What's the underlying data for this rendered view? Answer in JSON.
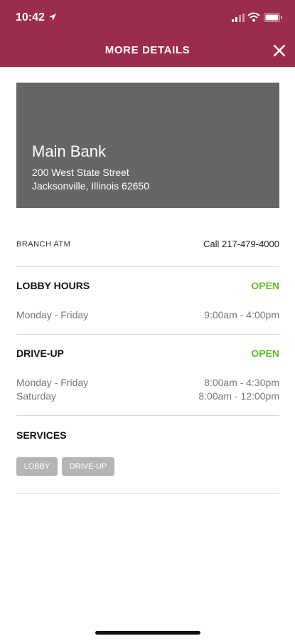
{
  "status_bar": {
    "time": "10:42"
  },
  "header": {
    "title": "MORE DETAILS"
  },
  "branch": {
    "name": "Main Bank",
    "address_line1": "200 West State Street",
    "address_line2": "Jacksonville, Illinois 62650",
    "types": "BRANCH  ATM",
    "call_label": "Call 217-479-4000"
  },
  "lobby": {
    "title": "LOBBY HOURS",
    "status": "OPEN",
    "rows": [
      {
        "days": "Monday - Friday",
        "hours": "9:00am - 4:00pm"
      }
    ]
  },
  "drive_up": {
    "title": "DRIVE-UP",
    "status": "OPEN",
    "rows": [
      {
        "days": "Monday - Friday",
        "hours": "8:00am - 4:30pm"
      },
      {
        "days": "Saturday",
        "hours": "8:00am - 12:00pm"
      }
    ]
  },
  "services": {
    "title": "SERVICES",
    "chips": [
      "LOBBY",
      "DRIVE-UP"
    ]
  },
  "colors": {
    "brand": "#9b2c4b",
    "open": "#5cbf2a",
    "hero_bg": "#666666",
    "chip": "#b5b5b5"
  },
  "icons": [
    "location-arrow-icon",
    "signal-icon",
    "wifi-icon",
    "battery-icon",
    "close-icon"
  ]
}
